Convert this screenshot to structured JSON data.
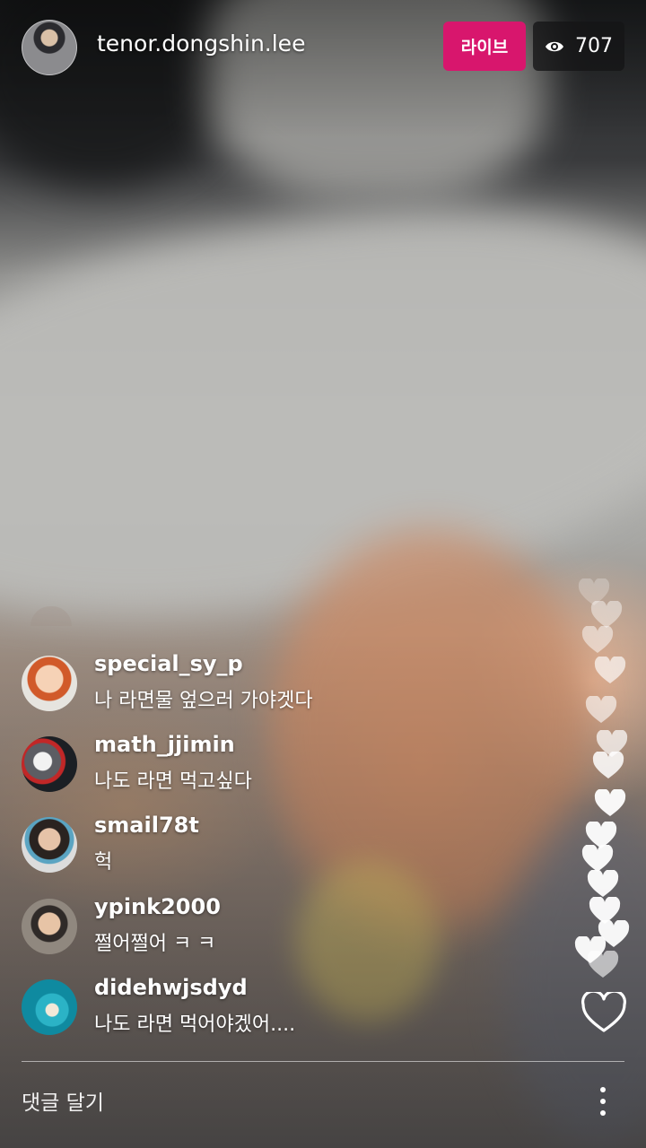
{
  "header": {
    "username": "tenor.dongshin.lee",
    "live_label": "라이브",
    "viewer_count": "707"
  },
  "comments": [
    {
      "username": "special_sy_p",
      "text": "나 라면물 엎으러 가야겟다"
    },
    {
      "username": "math_jjimin",
      "text": "나도 라면 먹고싶다"
    },
    {
      "username": "smail78t",
      "text": "헉"
    },
    {
      "username": "ypink2000",
      "text": "쩔어쩔어 ㅋ ㅋ"
    },
    {
      "username": "didehwjsdyd",
      "text": "나도 라면 먹어야겠어...."
    }
  ],
  "footer": {
    "comment_placeholder": "댓글 달기"
  },
  "icons": {
    "viewers": "eye-icon",
    "like": "heart-icon",
    "more": "more-options-icon"
  },
  "colors": {
    "live_badge": "#d8166d",
    "viewer_badge": "#141416"
  }
}
